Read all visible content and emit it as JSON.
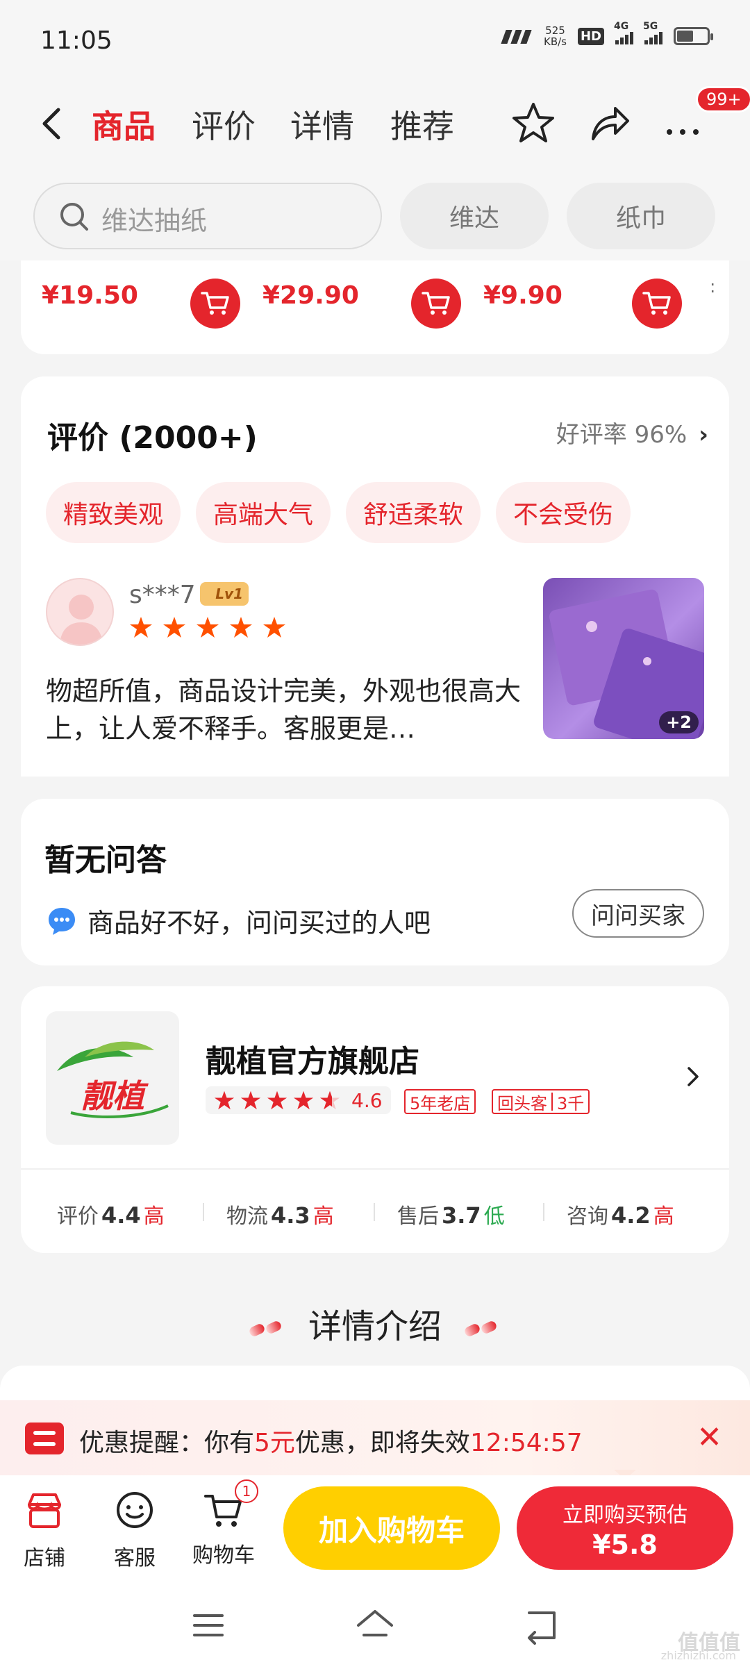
{
  "status_bar": {
    "time": "11:05",
    "speed_top": "525",
    "speed_unit": "KB/s",
    "hd": "HD",
    "net_a": "4G",
    "net_b": "5G"
  },
  "nav": {
    "tabs": [
      {
        "label": "商品",
        "active": true
      },
      {
        "label": "评价",
        "active": false
      },
      {
        "label": "详情",
        "active": false
      },
      {
        "label": "推荐",
        "active": false
      }
    ],
    "badge": "99+"
  },
  "search": {
    "placeholder": "维达抽纸",
    "chips": [
      "维达",
      "纸巾"
    ]
  },
  "related_prices": [
    "¥19.50",
    "¥29.90",
    "¥9.90"
  ],
  "reviews": {
    "title": "评价 (2000+)",
    "good_rate": "好评率 96%",
    "tags": [
      "精致美观",
      "高端大气",
      "舒适柔软",
      "不会受伤"
    ],
    "user": "s***7",
    "level": "Lv1",
    "stars": 5,
    "text": "物超所值，商品设计完美，外观也很高大上，让人爱不释手。客服更是…",
    "photo_more": "+2"
  },
  "qa": {
    "title": "暂无问答",
    "prompt": "商品好不好，问问买过的人吧",
    "button": "问问买家"
  },
  "store": {
    "logo_text": "靓植",
    "name": "靓植官方旗舰店",
    "rating": "4.6",
    "rating_stars": 4.6,
    "tag_years": "5年老店",
    "tag_returning": "回头客",
    "tag_returning_count": "3千",
    "metrics": [
      {
        "label": "评价",
        "score": "4.4",
        "level": "高",
        "type": "hi"
      },
      {
        "label": "物流",
        "score": "4.3",
        "level": "高",
        "type": "hi"
      },
      {
        "label": "售后",
        "score": "3.7",
        "level": "低",
        "type": "lo"
      },
      {
        "label": "咨询",
        "score": "4.2",
        "level": "高",
        "type": "hi"
      }
    ]
  },
  "details": {
    "title": "详情介绍"
  },
  "promo": {
    "prefix": "优惠提醒：你有",
    "amount": "5元",
    "suffix": "优惠，即将失效",
    "countdown": "12:54:57"
  },
  "bottom": {
    "store": "店铺",
    "service": "客服",
    "cart": "购物车",
    "cart_count": "1",
    "add_cart": "加入购物车",
    "buy_line1": "立即购买预估",
    "buy_line2": "¥5.8"
  },
  "watermark": {
    "main": "值值值",
    "sub": "zhizhizhi.com"
  },
  "colors": {
    "accent": "#e4252c",
    "yellow": "#ffcf00",
    "buy": "#ef2a38"
  }
}
